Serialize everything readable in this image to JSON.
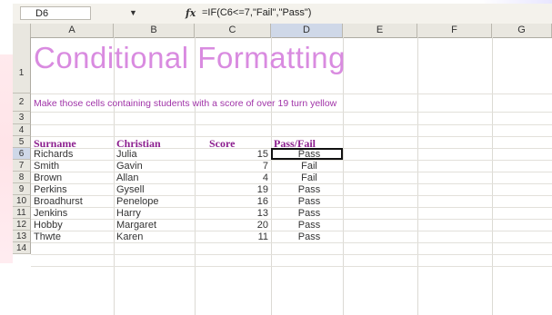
{
  "formula_bar": {
    "name_box": "D6",
    "name_box_arrow_icon": "dropdown-arrow-icon",
    "fx_label": "fx",
    "formula": "=IF(C6<=7,\"Fail\",\"Pass\")"
  },
  "columns": [
    "A",
    "B",
    "C",
    "D",
    "E",
    "F",
    "G"
  ],
  "rows": [
    "1",
    "2",
    "3",
    "4",
    "5",
    "6",
    "7",
    "8",
    "9",
    "10",
    "11",
    "12",
    "13",
    "14"
  ],
  "sheet": {
    "title": "Conditional Formatting",
    "subtitle": "Make those cells containing students with a score of over 19 turn yellow",
    "headers": {
      "surname": "Surname",
      "christian": "Christian",
      "score": "Score",
      "pass_fail": "Pass/Fail"
    },
    "students": [
      {
        "surname": "Richards",
        "christian": "Julia",
        "score": "15",
        "result": "Pass"
      },
      {
        "surname": "Smith",
        "christian": "Gavin",
        "score": "7",
        "result": "Fail"
      },
      {
        "surname": "Brown",
        "christian": "Allan",
        "score": "4",
        "result": "Fail"
      },
      {
        "surname": "Perkins",
        "christian": "Gysell",
        "score": "19",
        "result": "Pass"
      },
      {
        "surname": "Broadhurst",
        "christian": "Penelope",
        "score": "16",
        "result": "Pass"
      },
      {
        "surname": "Jenkins",
        "christian": "Harry",
        "score": "13",
        "result": "Pass"
      },
      {
        "surname": "Hobby",
        "christian": "Margaret",
        "score": "20",
        "result": "Pass"
      },
      {
        "surname": "Thwte",
        "christian": "Karen",
        "score": "11",
        "result": "Pass"
      }
    ]
  },
  "colors": {
    "title": "#d98be0",
    "subtitle": "#a033a8",
    "header": "#8c1f8f",
    "selection_header": "#cfd8e8"
  }
}
